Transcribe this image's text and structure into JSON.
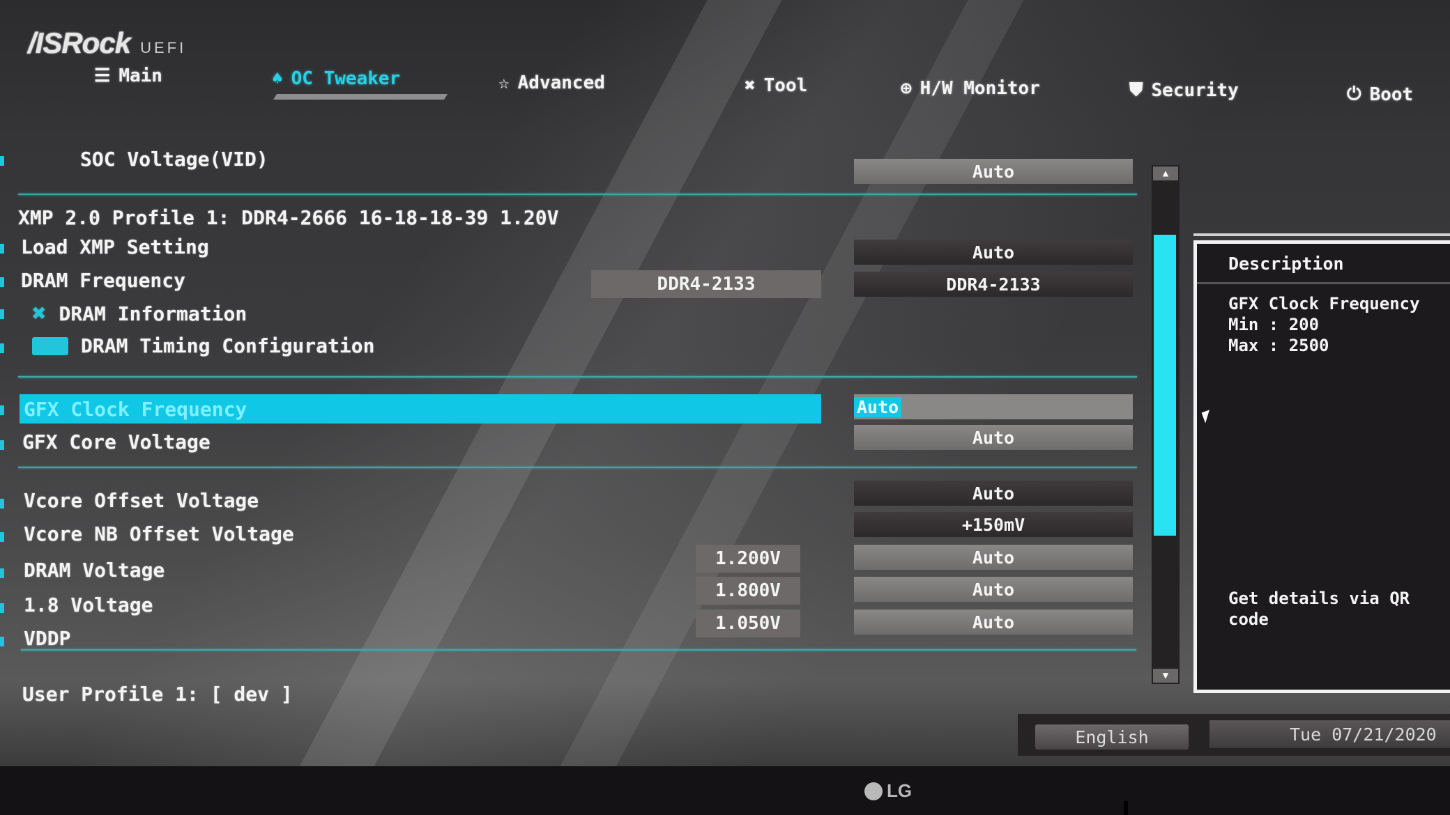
{
  "header": {
    "brand": "/ISRock",
    "product": "UEFI"
  },
  "tabs": [
    {
      "label": "Main",
      "icon": "list-icon",
      "glyph": "☰",
      "active": false
    },
    {
      "label": "OC Tweaker",
      "icon": "rocket-icon",
      "glyph": "♠",
      "active": true
    },
    {
      "label": "Advanced",
      "icon": "star-icon",
      "glyph": "☆",
      "active": false
    },
    {
      "label": "Tool",
      "icon": "tools-icon",
      "glyph": "✖",
      "active": false
    },
    {
      "label": "H/W Monitor",
      "icon": "crosshair-icon",
      "glyph": "⊕",
      "active": false
    },
    {
      "label": "Security",
      "icon": "shield-icon",
      "glyph": "⛊",
      "active": false
    },
    {
      "label": "Boot",
      "icon": "power-icon",
      "glyph": "⏻",
      "active": false
    }
  ],
  "settings": {
    "soc_voltage": {
      "label": "SOC Voltage(VID)",
      "value": "Auto"
    },
    "xmp_info": "XMP 2.0 Profile 1: DDR4-2666 16-18-18-39 1.20V",
    "load_xmp": {
      "label": "Load XMP Setting",
      "value": "Auto"
    },
    "dram_frequency": {
      "label": "DRAM Frequency",
      "current": "DDR4-2133",
      "value": "DDR4-2133"
    },
    "dram_information": {
      "label": "DRAM Information",
      "icon": "tools-icon"
    },
    "dram_timing": {
      "label": "DRAM Timing Configuration",
      "icon": "folder-icon"
    },
    "gfx_clock": {
      "label": "GFX Clock Frequency",
      "value": "Auto",
      "selected": true
    },
    "gfx_core_voltage": {
      "label": "GFX Core Voltage",
      "value": "Auto"
    },
    "vcore_offset": {
      "label": "Vcore Offset Voltage",
      "value": "Auto"
    },
    "vcore_nb_offset": {
      "label": "Vcore NB Offset Voltage",
      "value": "+150mV"
    },
    "dram_voltage": {
      "label": "DRAM Voltage",
      "current": "1.200V",
      "value": "Auto"
    },
    "v18": {
      "label": "1.8 Voltage",
      "current": "1.800V",
      "value": "Auto"
    },
    "vddp": {
      "label": "VDDP",
      "current": "1.050V",
      "value": "Auto"
    },
    "user_profile": "User Profile 1: [ dev ]"
  },
  "scrollbar": {
    "up": "▲",
    "down": "▼"
  },
  "description": {
    "title": "Description",
    "lines": [
      "GFX Clock Frequency",
      "Min : 200",
      "Max : 2500"
    ],
    "qr_hint": [
      "Get details via QR",
      "code"
    ]
  },
  "footer": {
    "language": "English",
    "datetime": "Tue 07/21/2020"
  },
  "monitor": {
    "brand": "LG"
  },
  "colors": {
    "accent": "#10c8e6",
    "divider": "#3fa7a8",
    "text": "#f4f4f4"
  }
}
